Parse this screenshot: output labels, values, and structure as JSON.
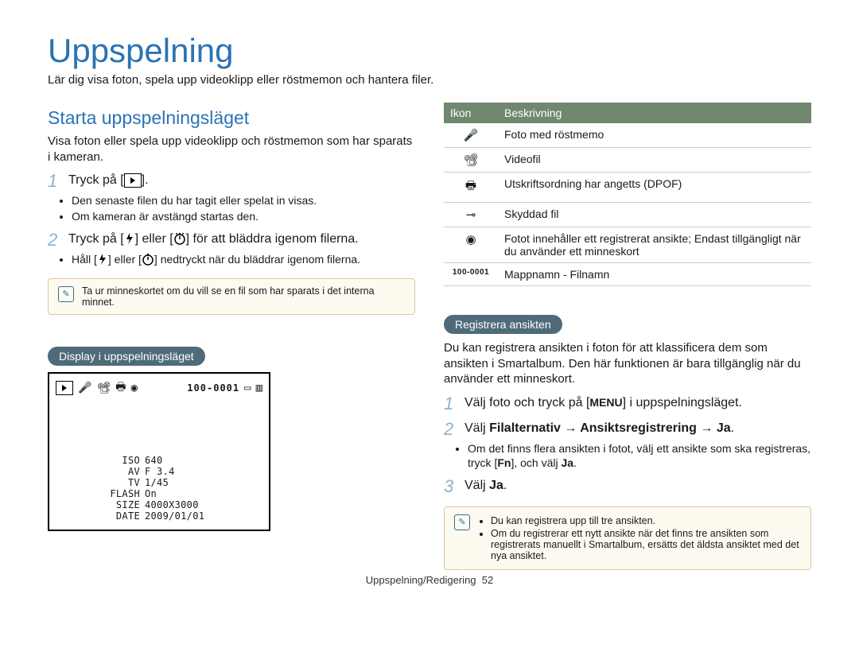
{
  "title": "Uppspelning",
  "intro": "Lär dig visa foton, spela upp videoklipp eller röstmemon och hantera filer.",
  "left": {
    "heading": "Starta uppspelningsläget",
    "lead": "Visa foton eller spela upp videoklipp och röstmemon som har sparats i kameran.",
    "step1": {
      "num": "1",
      "pre": "Tryck på [",
      "post": "]."
    },
    "step1_bullets": [
      "Den senaste filen du har tagit eller spelat in visas.",
      "Om kameran är avstängd startas den."
    ],
    "step2": {
      "num": "2",
      "pre": "Tryck på [",
      "mid": "] eller [",
      "post": "] för att bläddra igenom filerna."
    },
    "step2_bullets_pre": "Håll [",
    "step2_bullets_mid": "] eller [",
    "step2_bullets_post": "] nedtryckt när du bläddrar igenom filerna.",
    "note1": "Ta ur minneskortet om du vill se en fil som har sparats i det interna minnet.",
    "pill_display": "Display i uppspelningsläget",
    "camera": {
      "filename": "100-0001",
      "iso_label": "ISO",
      "iso": "640",
      "av_label": "AV",
      "av": "F 3.4",
      "tv_label": "TV",
      "tv": "1/45",
      "flash_label": "FLASH",
      "flash": "On",
      "size_label": "SIZE",
      "size": "4000X3000",
      "date_label": "DATE",
      "date": "2009/01/01"
    }
  },
  "right": {
    "table_header_icon": "Ikon",
    "table_header_desc": "Beskrivning",
    "rows": {
      "r0": "Foto med röstmemo",
      "r1": "Videofil",
      "r2": "Utskriftsordning har angetts (DPOF)",
      "r3": "Skyddad fil",
      "r4": "Fotot innehåller ett registrerat ansikte; Endast tillgängligt när du använder ett minneskort",
      "r5_icon": "100-0001",
      "r5": "Mappnamn - Filnamn"
    },
    "pill_register": "Registrera ansikten",
    "register_intro": "Du kan registrera ansikten i foton för att klassificera dem som ansikten i Smartalbum. Den här funktionen är bara tillgänglig när du använder ett minneskort.",
    "rstep1": {
      "num": "1",
      "pre": "Välj foto och tryck på [",
      "menu": "MENU",
      "post": "] i uppspelningsläget."
    },
    "rstep2": {
      "num": "2",
      "text_pre": "Välj ",
      "bold": "Filalternativ → Ansiktsregistrering → Ja",
      "text_post": "."
    },
    "rstep2_bullet_pre": "Om det finns flera ansikten i fotot, välj ett ansikte som ska registreras, tryck [",
    "rstep2_bullet_fn": "Fn",
    "rstep2_bullet_mid": "], och välj ",
    "rstep2_bullet_ja": "Ja",
    "rstep2_bullet_post": ".",
    "rstep3": {
      "num": "3",
      "pre": "Välj ",
      "ja": "Ja",
      "post": "."
    },
    "note2": [
      "Du kan registrera upp till tre ansikten.",
      "Om du registrerar ett nytt ansikte när det finns tre ansikten som registrerats manuellt i Smartalbum, ersätts det äldsta ansiktet med det nya ansiktet."
    ]
  },
  "footer": {
    "section": "Uppspelning/Redigering",
    "page": "52"
  }
}
